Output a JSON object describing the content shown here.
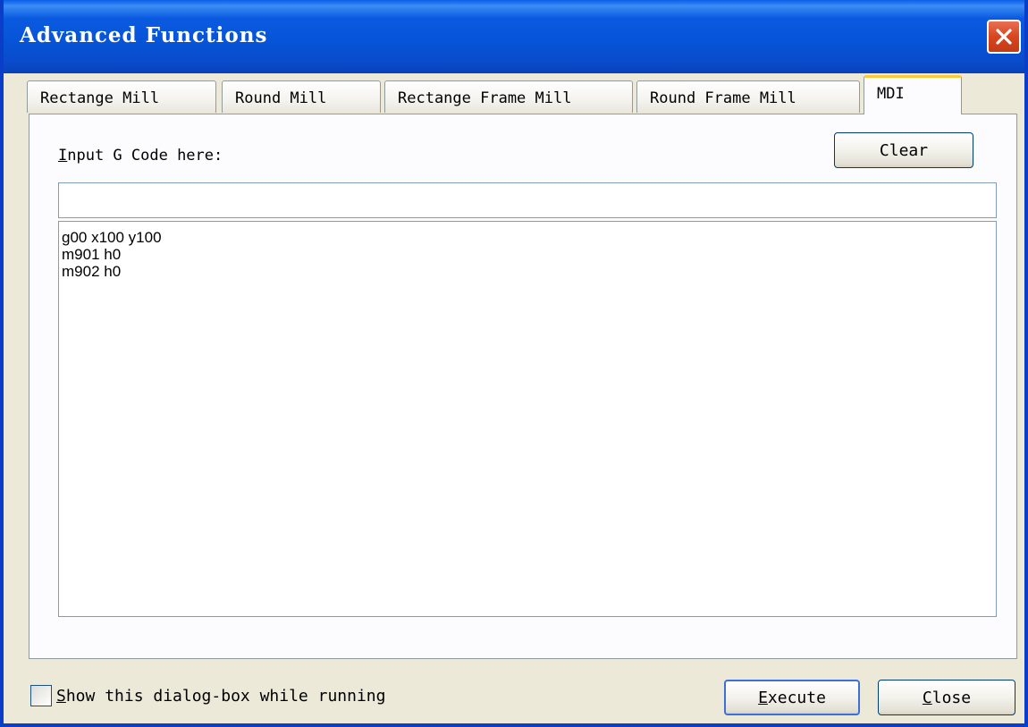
{
  "window": {
    "title": "Advanced Functions",
    "accent": "#0A3EC8",
    "close_color": "#D8451F"
  },
  "tabs": [
    {
      "label": "Rectange Mill",
      "active": false
    },
    {
      "label": "Round Mill",
      "active": false
    },
    {
      "label": "Rectange Frame Mill",
      "active": false
    },
    {
      "label": "Round Frame Mill",
      "active": false
    },
    {
      "label": "MDI",
      "active": true
    }
  ],
  "mdi": {
    "input_label_first": "I",
    "input_label_rest": "nput G Code here:",
    "clear_label": "Clear",
    "gcode_value": "",
    "history": [
      "g00 x100 y100",
      "m901 h0",
      "m902 h0"
    ]
  },
  "footer": {
    "checkbox_label_first": "S",
    "checkbox_label_rest": "how this dialog-box while running",
    "checkbox_checked": false,
    "execute_first": "E",
    "execute_rest": "xecute",
    "close_first": "C",
    "close_rest": "lose"
  },
  "icons": {
    "window_close": "close-x-icon"
  }
}
